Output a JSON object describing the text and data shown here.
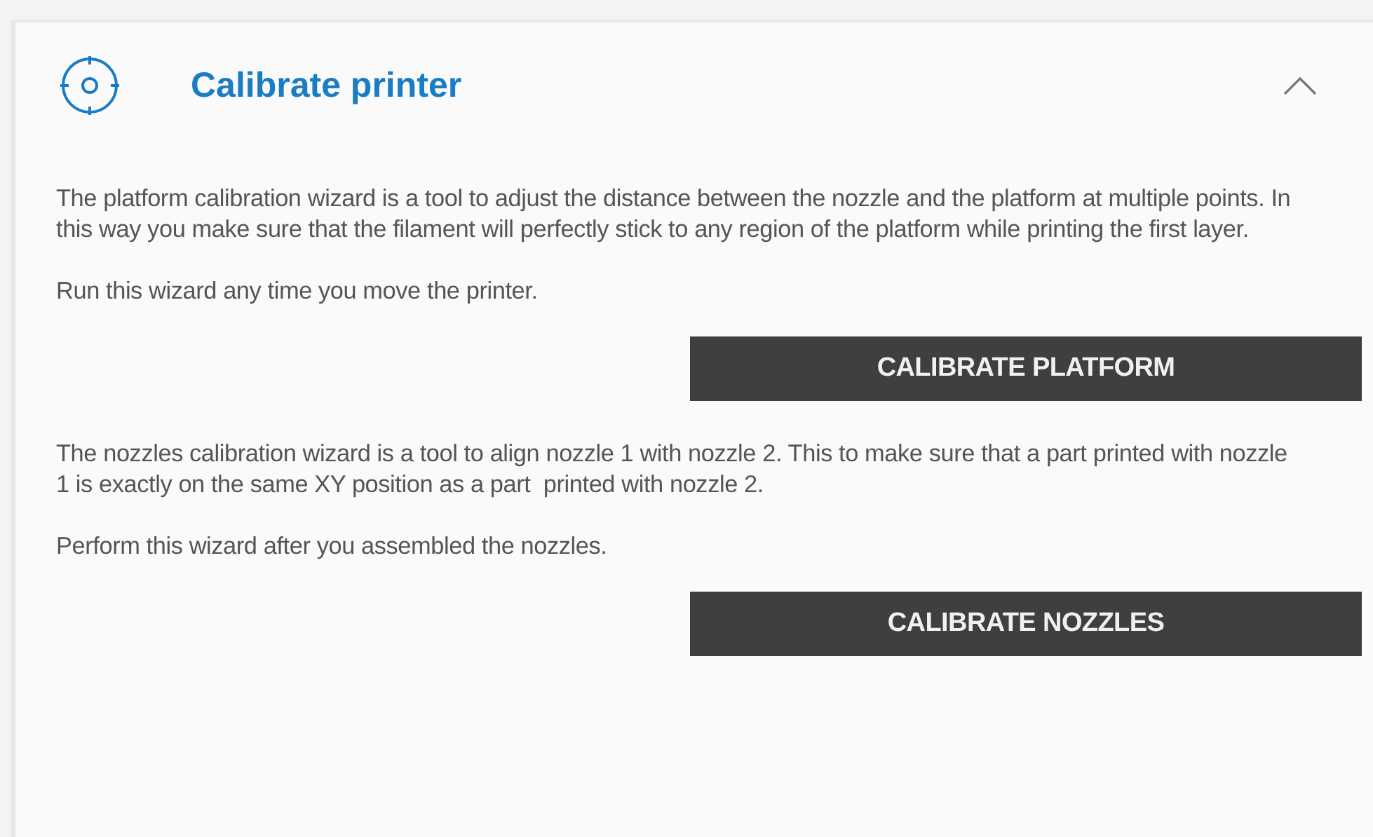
{
  "panel": {
    "title": "Calibrate printer",
    "expanded": true,
    "sections": [
      {
        "paragraphs": [
          "The platform calibration wizard is a tool to adjust the distance between the nozzle and the platform at multiple points. In this way you make sure that the filament will perfectly stick to any region of the platform while printing the first layer.",
          "Run this wizard any time you move the printer."
        ],
        "button": "CALIBRATE PLATFORM"
      },
      {
        "paragraphs": [
          "The nozzles calibration wizard is a tool to align nozzle 1 with nozzle 2. This to make sure that a part printed with nozzle 1 is exactly on the same XY position as a part  printed with nozzle 2.",
          "Perform this wizard after you assembled the nozzles."
        ],
        "button": "CALIBRATE NOZZLES"
      }
    ]
  }
}
